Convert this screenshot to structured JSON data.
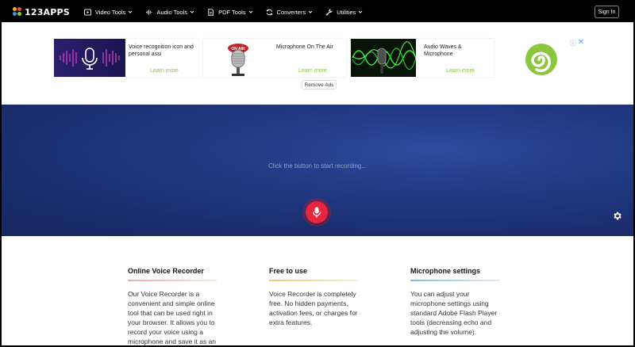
{
  "nav": {
    "logo": "123APPS",
    "menu": [
      {
        "label": "Video Tools",
        "icon": "video-icon"
      },
      {
        "label": "Audio Tools",
        "icon": "audio-icon"
      },
      {
        "label": "PDF Tools",
        "icon": "pdf-icon"
      },
      {
        "label": "Converters",
        "icon": "converters-icon"
      },
      {
        "label": "Utilities",
        "icon": "utilities-icon"
      }
    ],
    "signin": "Sign In"
  },
  "ads": {
    "items": [
      {
        "title": "Voice recognition icon and personal assi",
        "link": "Learn more"
      },
      {
        "title": "Microphone On The Air",
        "link": "Learn more"
      },
      {
        "title": "Audio Waves & Microphone",
        "link": "Learn more"
      }
    ],
    "info_icon": "ⓘ",
    "close_icon": "✕",
    "remove_label": "Remove Ads"
  },
  "hero": {
    "prompt": "Click the button to start recording..."
  },
  "info": {
    "columns": [
      {
        "title": "Online Voice Recorder",
        "text": "Our Voice Recorder is a convenient and simple online tool that can be used right in your browser. It allows you to record your voice using a microphone and save it as an",
        "line_color": "#f0a8a0"
      },
      {
        "title": "Free to use",
        "text": "Voice Recorder is completely free. No hidden payments, activation fees, or charges for extra features.",
        "line_color": "#f5c27a"
      },
      {
        "title": "Microphone settings",
        "text": "You can adjust your microphone settings using standard Adobe Flash Player tools (decreasing echo and adjusting the volume).",
        "line_color": "#7fb8e6"
      }
    ]
  }
}
